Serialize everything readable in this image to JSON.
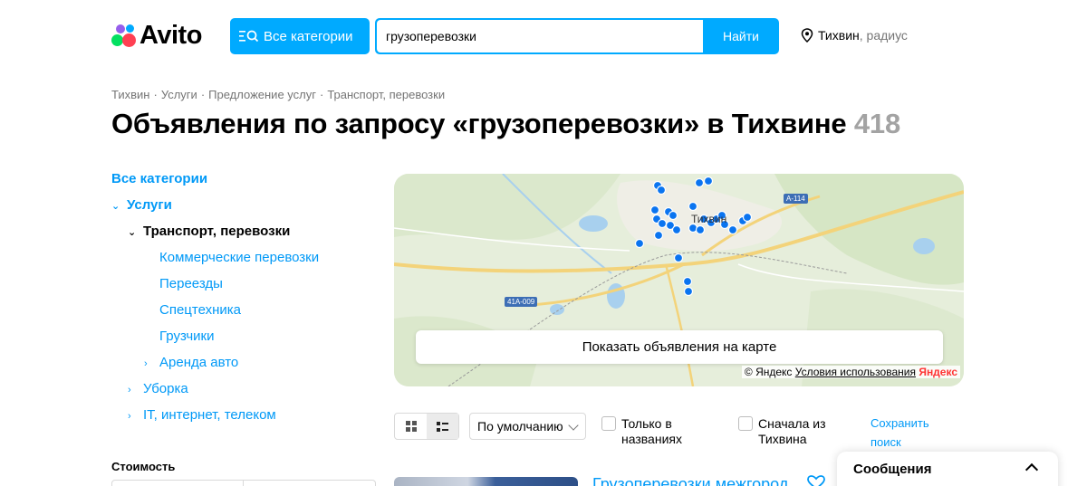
{
  "header": {
    "logo_text": "Avito",
    "categories_button": "Все категории",
    "search": {
      "value": "грузоперевозки",
      "button": "Найти"
    },
    "location": {
      "city": "Тихвин",
      "radius": ", радиус"
    }
  },
  "breadcrumb": [
    "Тихвин",
    "Услуги",
    "Предложение услуг",
    "Транспорт, перевозки"
  ],
  "title": {
    "text": "Объявления по запросу «грузоперевозки» в Тихвине",
    "count": "418"
  },
  "sidebar": {
    "all_categories": "Все категории",
    "services": "Услуги",
    "transport": "Транспорт, перевозки",
    "sub_items": [
      "Коммерческие перевозки",
      "Переезды",
      "Спецтехника",
      "Грузчики"
    ],
    "rent_auto": "Аренда авто",
    "cleaning": "Уборка",
    "it": "IT, интернет, телеком"
  },
  "price_label": "Стоимость",
  "map": {
    "show_button": "Показать объявления на карте",
    "credit_prefix": "© Яндекс",
    "terms": "Условия использования",
    "yandex_logo": "Яндекс",
    "road_a114": "A-114",
    "road_41a": "41A-009",
    "town_label": "Тихвин"
  },
  "toolbar": {
    "sort": "По умолчанию",
    "only_titles": "Только в названиях",
    "from_city": "Сначала из Тихвина",
    "save_search": "Сохранить поиск"
  },
  "listing": {
    "title": "Грузоперевозки межгород"
  },
  "messages": {
    "title": "Сообщения"
  },
  "colors": {
    "accent": "#00aaff",
    "link": "#0099f7",
    "pin": "#0a74f0"
  }
}
